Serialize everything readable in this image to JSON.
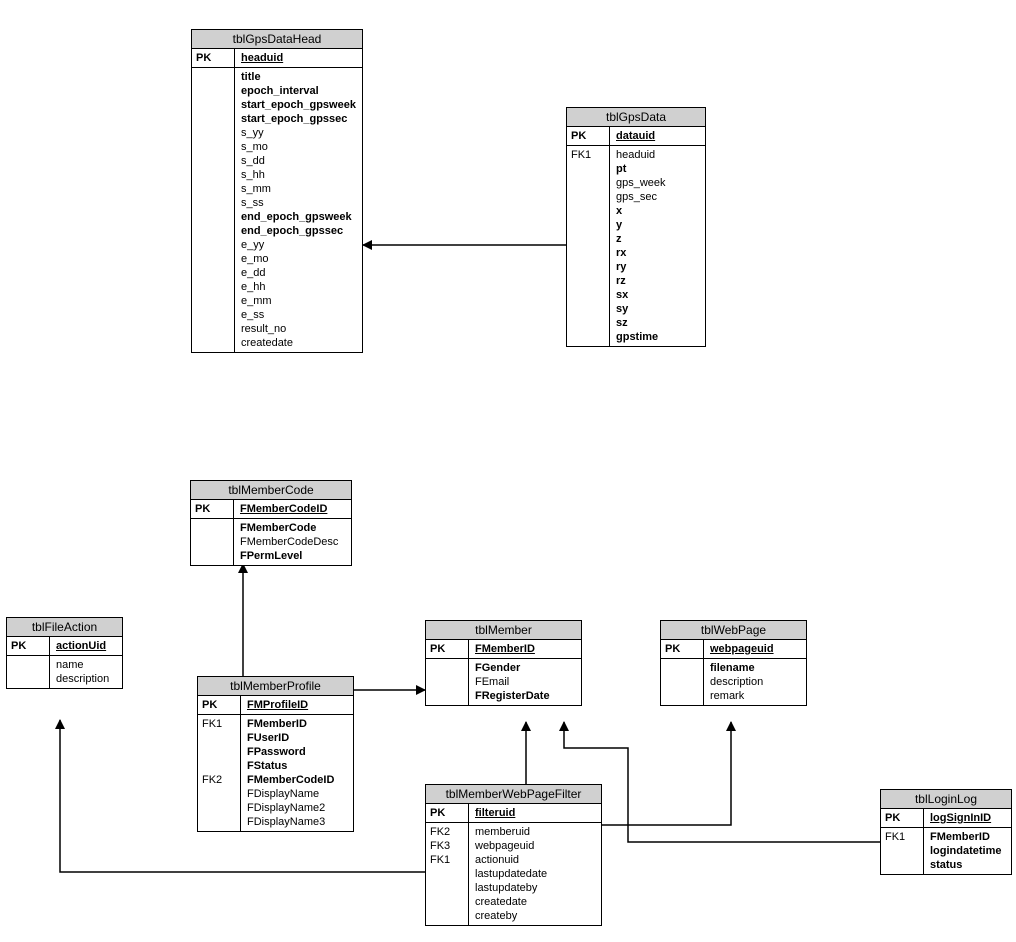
{
  "entities": {
    "tblGpsDataHead": {
      "title": "tblGpsDataHead",
      "pkLabel": "PK",
      "pkField": "headuid",
      "keys": [
        ""
      ],
      "fields": [
        "title",
        "epoch_interval",
        "start_epoch_gpsweek",
        "start_epoch_gpssec",
        "s_yy",
        "s_mo",
        "s_dd",
        "s_hh",
        "s_mm",
        "s_ss",
        "end_epoch_gpsweek",
        "end_epoch_gpssec",
        "e_yy",
        "e_mo",
        "e_dd",
        "e_hh",
        "e_mm",
        "e_ss",
        "result_no",
        "createdate"
      ],
      "fieldBold": [
        true,
        true,
        true,
        true,
        false,
        false,
        false,
        false,
        false,
        false,
        true,
        true,
        false,
        false,
        false,
        false,
        false,
        false,
        false,
        false
      ]
    },
    "tblGpsData": {
      "title": "tblGpsData",
      "pkLabel": "PK",
      "pkField": "datauid",
      "keys": [
        "FK1",
        "",
        "",
        "",
        "",
        "",
        "",
        "",
        "",
        "",
        "",
        "",
        "",
        ""
      ],
      "fields": [
        "headuid",
        "pt",
        "gps_week",
        "gps_sec",
        "x",
        "y",
        "z",
        "rx",
        "ry",
        "rz",
        "sx",
        "sy",
        "sz",
        "gpstime"
      ],
      "fieldBold": [
        false,
        true,
        false,
        false,
        true,
        true,
        true,
        true,
        true,
        true,
        true,
        true,
        true,
        true
      ]
    },
    "tblMemberCode": {
      "title": "tblMemberCode",
      "pkLabel": "PK",
      "pkField": "FMemberCodeID",
      "keys": [
        "",
        "",
        ""
      ],
      "fields": [
        "FMemberCode",
        "FMemberCodeDesc",
        "FPermLevel"
      ],
      "fieldBold": [
        true,
        false,
        true
      ]
    },
    "tblFileAction": {
      "title": "tblFileAction",
      "pkLabel": "PK",
      "pkField": "actionUid",
      "keys": [
        "",
        ""
      ],
      "fields": [
        "name",
        "description"
      ],
      "fieldBold": [
        false,
        false
      ]
    },
    "tblMemberProfile": {
      "title": "tblMemberProfile",
      "pkLabel": "PK",
      "pkField": "FMProfileID",
      "keys": [
        "FK1",
        "",
        "",
        "",
        "FK2",
        "",
        "",
        ""
      ],
      "fields": [
        "FMemberID",
        "FUserID",
        "FPassword",
        "FStatus",
        "FMemberCodeID",
        "FDisplayName",
        "FDisplayName2",
        "FDisplayName3"
      ],
      "fieldBold": [
        true,
        true,
        true,
        true,
        true,
        false,
        false,
        false
      ]
    },
    "tblMember": {
      "title": "tblMember",
      "pkLabel": "PK",
      "pkField": "FMemberID",
      "keys": [
        "",
        "",
        ""
      ],
      "fields": [
        "FGender",
        "FEmail",
        "FRegisterDate"
      ],
      "fieldBold": [
        true,
        false,
        true
      ]
    },
    "tblWebPage": {
      "title": "tblWebPage",
      "pkLabel": "PK",
      "pkField": "webpageuid",
      "keys": [
        "",
        "",
        ""
      ],
      "fields": [
        "filename",
        "description",
        "remark"
      ],
      "fieldBold": [
        true,
        false,
        false
      ]
    },
    "tblMemberWebPageFilter": {
      "title": "tblMemberWebPageFilter",
      "pkLabel": "PK",
      "pkField": "filteruid",
      "keys": [
        "FK2",
        "FK3",
        "FK1",
        "",
        "",
        "",
        ""
      ],
      "fields": [
        "memberuid",
        "webpageuid",
        "actionuid",
        "lastupdatedate",
        "lastupdateby",
        "createdate",
        "createby"
      ],
      "fieldBold": [
        false,
        false,
        false,
        false,
        false,
        false,
        false
      ]
    },
    "tblLoginLog": {
      "title": "tblLoginLog",
      "pkLabel": "PK",
      "pkField": "logSignInID",
      "keys": [
        "FK1",
        "",
        ""
      ],
      "fields": [
        "FMemberID",
        "logindatetime",
        "status"
      ],
      "fieldBold": [
        true,
        true,
        true
      ]
    }
  }
}
